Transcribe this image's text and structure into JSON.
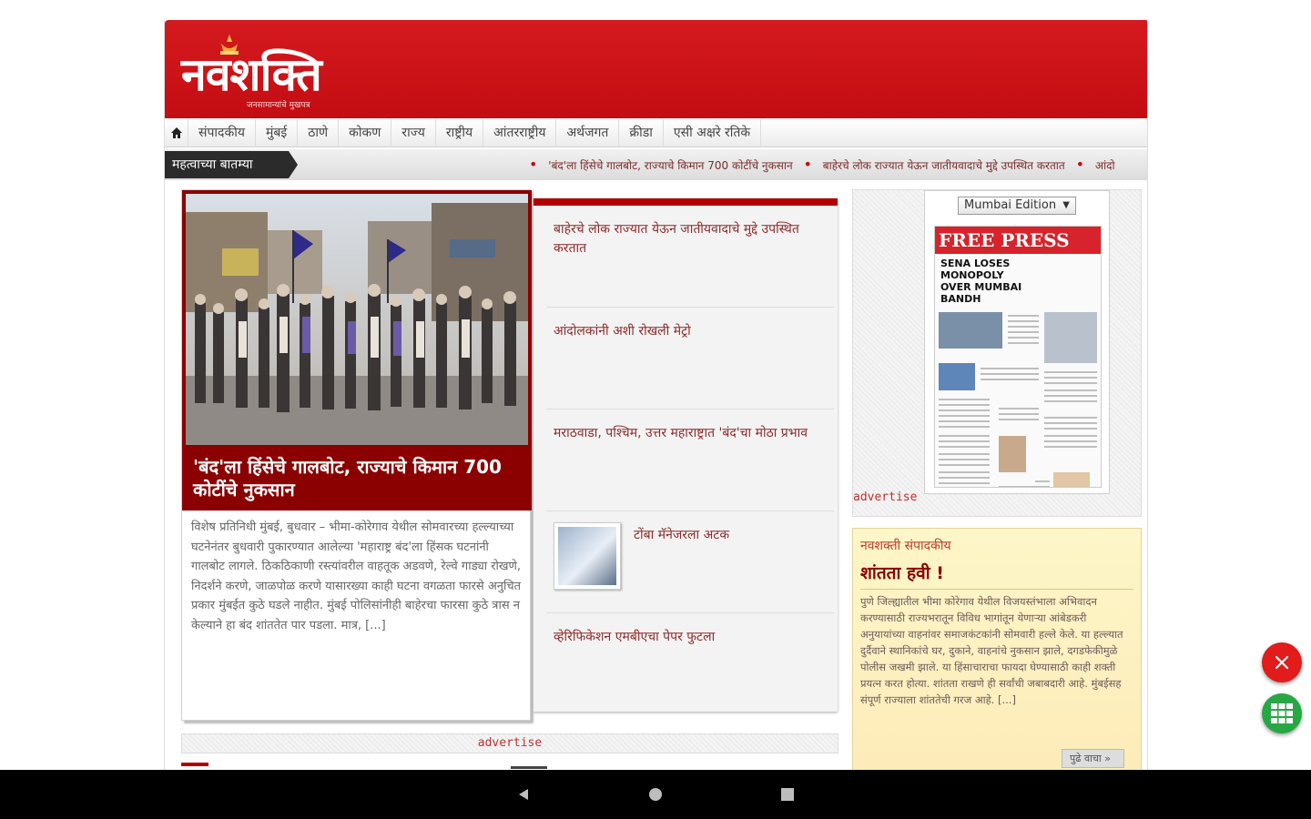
{
  "header": {
    "logo_text": "नवशक्ति",
    "logo_tagline": "जनसामान्यांचे मुखपत्र"
  },
  "nav": {
    "items": [
      "संपादकीय",
      "मुंबई",
      "ठाणे",
      "कोकण",
      "राज्य",
      "राष्ट्रीय",
      "आंतरराष्ट्रीय",
      "अर्थजगत",
      "क्रीडा",
      "एसी अक्षरे रतिके"
    ]
  },
  "ticker": {
    "label": "महत्वाच्या बातम्या",
    "items": [
      "'बंद'ला हिंसेचे गालबोट, राज्याचे किमान 700 कोटींचे नुकसान",
      "बाहेरचे लोक राज्यात येऊन जातीयवादाचे मुद्दे उपस्थित करतात",
      "आंदो"
    ]
  },
  "lead": {
    "headline": "'बंद'ला हिंसेचे गालबोट, राज्याचे किमान 700 कोटींचे नुकसान",
    "body": "विशेष प्रतिनिधी मुंबई, बुधवार – भीमा-कोरेगाव येथील सोमवारच्या हल्ल्याच्या घटनेनंतर बुधवारी पुकारण्यात आलेल्या 'महाराष्ट्र बंद'ला हिंसक घटनांनी गालबोट लागले. ठिकठिकाणी रस्त्यांवरील वाहतूक अडवणे, रेल्वे गाड्या रोखणे, निदर्शने करणे, जाळपोळ करणे यासारख्या काही घटना वगळता फारसे अनुचित प्रकार मुंबईत कुठे घडले नाहीत. मुंबई पोलिसांनीही बाहेरचा फारसा कुठे त्रास न केल्याने हा बंद शांततेत पार पडला. मात्र, [...]"
  },
  "headlines": [
    {
      "text": "बाहेरचे लोक राज्यात येऊन जातीयवादाचे मुद्दे उपस्थित करतात"
    },
    {
      "text": "आंदोलकांनी अशी रोखली मेट्रो"
    },
    {
      "text": "मराठवाडा, पश्चिम, उत्तर महाराष्ट्रात 'बंद'चा मोठा प्रभाव"
    },
    {
      "text": "टोंबा मॅनेजरला अटक"
    },
    {
      "text": "व्हेरिफिकेशन एमबीएचा पेपर फुटला"
    }
  ],
  "edition": {
    "selected": "Mumbai Edition",
    "paper_masthead": "FREE PRESS",
    "paper_headline": "SENA LOSES MONOPOLY OVER MUMBAI BANDH",
    "advertise": "advertise"
  },
  "editorial": {
    "kicker": "नवशक्ती संपादकीय",
    "title": "शांतता हवी !",
    "body": "पुणे जिल्ह्यातील भीमा कोरेगाव येथील विजयस्तंभाला अभिवादन करण्यासाठी राज्यभरातून विविध भागांतून येणाऱ्या आंबेडकरी अनुयायांच्या वाहनांवर समाजकंटकांनी सोमवारी हल्ले केले. या हल्ल्यात दुर्दैवाने स्थानिकांचे घर, दुकाने, वाहनांचे नुकसान झाले, दगडफेकीमुळे पोलीस जखमी झाले. या हिंसाचाराचा फायदा घेण्यासाठी काही शक्ती प्रयत्न करत होत्या. शांतता राखणे ही सर्वांची जबाबदारी आहे. मुंबईसह संपूर्ण राज्याला शांततेची गरज आहे. [...]",
    "more": "पुढे वाचा »"
  },
  "bottom_ad": {
    "label": "advertise"
  },
  "colors": {
    "brand_red": "#c8101a",
    "dark_red": "#8b0000",
    "fab_close": "#e21b1b",
    "fab_grid": "#28a745"
  }
}
